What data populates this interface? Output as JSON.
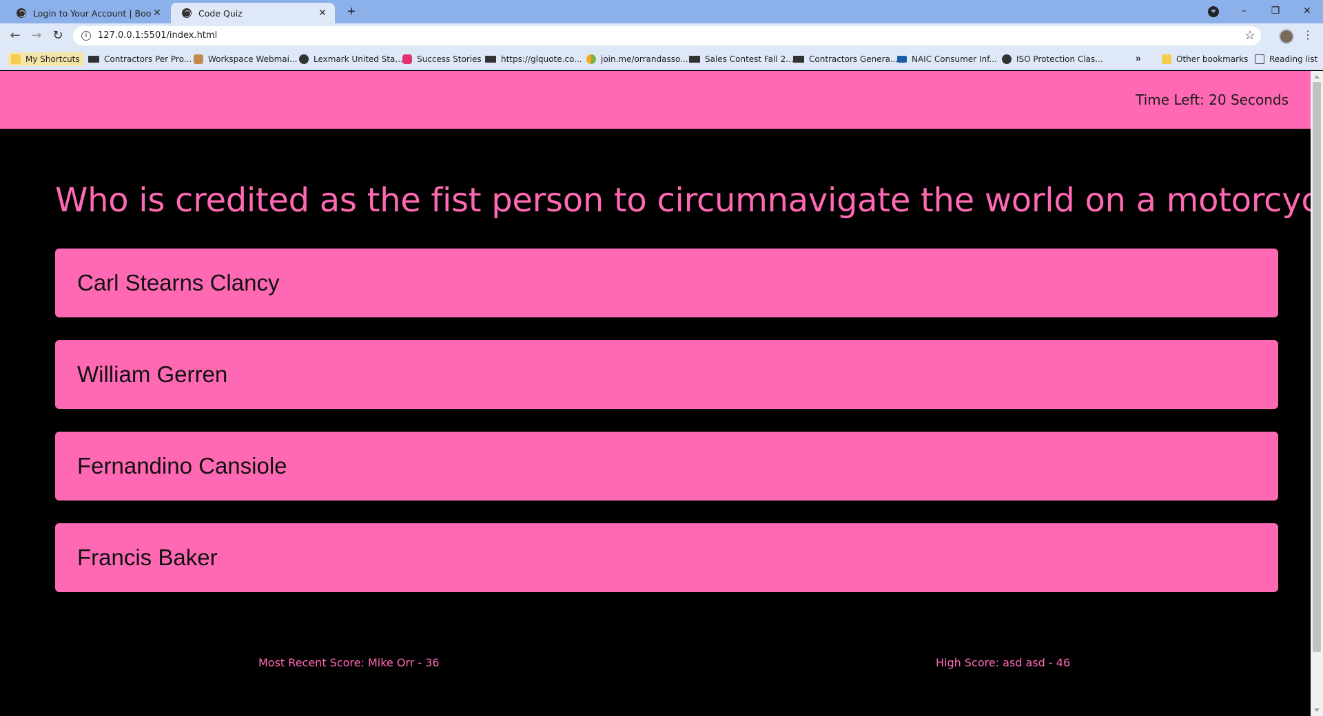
{
  "browser": {
    "tabs": [
      {
        "title": "Login to Your Account | Bootcamp",
        "active": false
      },
      {
        "title": "Code Quiz",
        "active": true
      }
    ],
    "new_tab_label": "+",
    "window_controls": {
      "minimize": "–",
      "restore": "❐",
      "close": "✕"
    },
    "nav": {
      "back": "←",
      "forward": "→",
      "reload": "↻"
    },
    "url": "127.0.0.1:5501/index.html",
    "info_icon": "i",
    "star_icon": "☆",
    "menu_icon": "⋮",
    "bookmarks": [
      {
        "label": "My Shortcuts",
        "icon": "folder-icon"
      },
      {
        "label": "Contractors Per Pro...",
        "icon": "grr-icon"
      },
      {
        "label": "Workspace Webmai...",
        "icon": "hand-icon"
      },
      {
        "label": "Lexmark United Sta...",
        "icon": "globe-icon"
      },
      {
        "label": "Success Stories",
        "icon": "instagram-icon"
      },
      {
        "label": "https://glquote.co...",
        "icon": "grr-icon"
      },
      {
        "label": "join.me/orrandasso...",
        "icon": "joinme-icon"
      },
      {
        "label": "Sales Contest Fall 2...",
        "icon": "grr-icon"
      },
      {
        "label": "Contractors Genera...",
        "icon": "grr-icon"
      },
      {
        "label": "NAIC Consumer Inf...",
        "icon": "naic-icon"
      },
      {
        "label": "ISO Protection Clas...",
        "icon": "globe-icon"
      }
    ],
    "bookmarks_more": "»",
    "other_bookmarks": "Other bookmarks",
    "reading_list": "Reading list"
  },
  "quiz": {
    "timer": "Time Left: 20 Seconds",
    "question": "Who is credited as the fist person to circumnavigate the world on a motorcycle?",
    "answers": [
      "Carl Stearns Clancy",
      "William Gerren",
      "Fernandino Cansiole",
      "Francis Baker"
    ],
    "recent_score": "Most Recent Score: Mike Orr - 36",
    "high_score": "High Score: asd asd - 46"
  },
  "colors": {
    "accent": "#ff69b4",
    "background": "#000000",
    "chrome": "#dfe8f7",
    "tabstrip": "#8cb0ea"
  }
}
